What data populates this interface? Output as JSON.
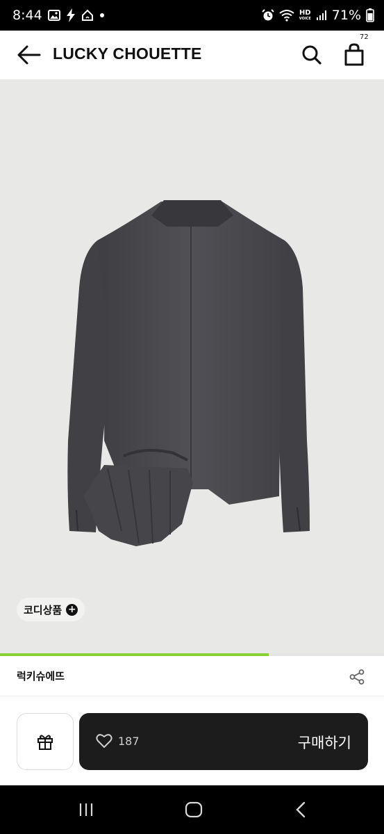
{
  "status_bar": {
    "time": "8:44",
    "hd_top": "HD",
    "hd_bottom": "VOICE",
    "battery": "71%",
    "icons": [
      "image-icon",
      "flash-icon",
      "home-network-icon",
      "dot-icon",
      "alarm-icon",
      "wifi-icon",
      "signal-icon",
      "battery-icon"
    ]
  },
  "header": {
    "brand": "LUCKY CHOUETTE",
    "cart_count": "72",
    "icons": [
      "back-arrow-icon",
      "search-icon",
      "shopping-bag-icon"
    ]
  },
  "product": {
    "image_alt": "gray jacket back view with ruffle",
    "colors": {
      "background": "#e8e8e7",
      "jacket": "#4a4a4e"
    },
    "coordi_label": "코디상품",
    "coordi_icon": "plus-circle-icon"
  },
  "progress": {
    "fraction": 0.7,
    "color": "#86d130"
  },
  "seller": {
    "name": "럭키슈에뜨",
    "share_icon": "share-icon"
  },
  "actions": {
    "gift_icon": "gift-icon",
    "like_icon": "heart-icon",
    "like_count": "187",
    "buy_label": "구매하기",
    "buy_color": "#1c1c1c"
  },
  "nav": {
    "icons": [
      "recent-apps-icon",
      "home-icon",
      "back-icon"
    ]
  }
}
